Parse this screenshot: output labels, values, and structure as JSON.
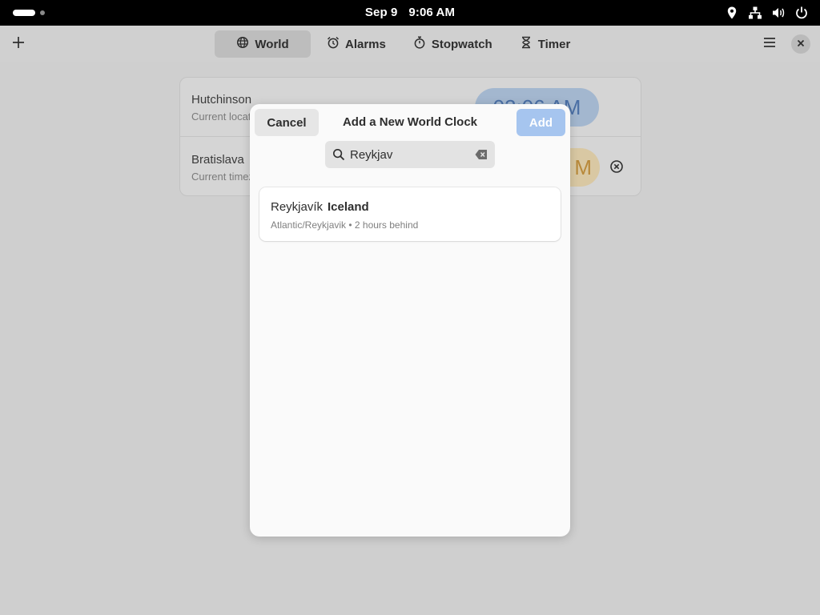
{
  "system_bar": {
    "date": "Sep 9",
    "time": "9:06 AM",
    "tray_icons": [
      "location-icon",
      "network-icon",
      "volume-icon",
      "power-icon"
    ]
  },
  "header": {
    "tabs": [
      {
        "label": "World",
        "icon": "globe-icon",
        "active": true
      },
      {
        "label": "Alarms",
        "icon": "alarm-icon",
        "active": false
      },
      {
        "label": "Stopwatch",
        "icon": "stopwatch-icon",
        "active": false
      },
      {
        "label": "Timer",
        "icon": "hourglass-icon",
        "active": false
      }
    ]
  },
  "world_list": [
    {
      "city": "Hutchinson",
      "subtitle": "Current locati",
      "time": "02:06 AM"
    },
    {
      "city": "Bratislava",
      "subtitle": "Current timez",
      "time": "M"
    }
  ],
  "dialog": {
    "title": "Add a New World Clock",
    "cancel_label": "Cancel",
    "add_label": "Add",
    "search_value": "Reykjav",
    "results": [
      {
        "city": "Reykjavík",
        "country": "Iceland",
        "detail": "Atlantic/Reykjavik • 2 hours behind"
      }
    ]
  },
  "colors": {
    "accent": "#a6c5ef",
    "dialog_bg": "#fafafa",
    "system_bar_bg": "#000000"
  }
}
